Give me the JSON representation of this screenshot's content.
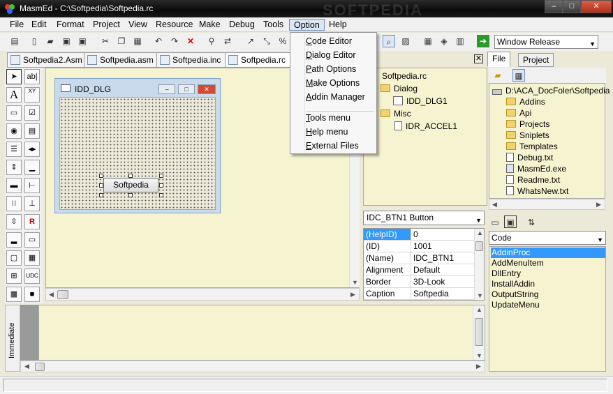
{
  "window": {
    "title": "MasmEd - C:\\Softpedia\\Softpedia.rc",
    "watermark": "SOFTPEDIA",
    "controls": {
      "minimize": "–",
      "maximize": "□",
      "close": "✕"
    }
  },
  "menubar": {
    "items": [
      "File",
      "Edit",
      "Format",
      "Project",
      "View",
      "Resource",
      "Make",
      "Debug",
      "Tools",
      "Option",
      "Help"
    ],
    "active": "Option"
  },
  "option_menu": {
    "group1": [
      {
        "label": "Code Editor",
        "accel": "C"
      },
      {
        "label": "Dialog Editor",
        "accel": "D"
      },
      {
        "label": "Path Options",
        "accel": "P"
      },
      {
        "label": "Make Options",
        "accel": "M"
      },
      {
        "label": "Addin Manager",
        "accel": "A"
      }
    ],
    "group2": [
      {
        "label": "Tools menu",
        "accel": "T"
      },
      {
        "label": "Help menu",
        "accel": "H"
      },
      {
        "label": "External Files",
        "accel": "E"
      }
    ]
  },
  "toolbar": {
    "build_config": "Window Release"
  },
  "doc_tabs": [
    {
      "label": "Softpedia2.Asm",
      "active": false
    },
    {
      "label": "Softpedia.asm",
      "active": false
    },
    {
      "label": "Softpedia.inc",
      "active": false
    },
    {
      "label": "Softpedia.rc",
      "active": true
    }
  ],
  "toolbox": {
    "tools": [
      "pointer-icon",
      "edit-box-icon",
      "static-text-icon",
      "groupbox-icon",
      "button-icon",
      "checkbox-icon",
      "radio-icon",
      "combo-icon",
      "listbox-icon",
      "tabstrip-icon",
      "scrollbar-v-icon",
      "progress-icon",
      "hscroll-icon",
      "treeview-icon",
      "listview-icon",
      "trackbar-icon",
      "updown-icon",
      "rich-edit-icon",
      "statusbar-icon",
      "toolbar-icon",
      "image-icon",
      "grid-icon",
      "animate-icon",
      "udc-icon",
      "shape-icon",
      "color-icon"
    ],
    "labels": {
      "edit": "ab|",
      "static": "A",
      "group": "XY",
      "udc": "UDC"
    }
  },
  "dialog": {
    "title": "IDD_DLG",
    "button_label": "Softpedia"
  },
  "resource_tree": {
    "root": "Softpedia.rc",
    "nodes": [
      {
        "label": "Dialog",
        "type": "folder",
        "level": 1
      },
      {
        "label": "IDD_DLG1",
        "type": "dialog",
        "level": 2
      },
      {
        "label": "Misc",
        "type": "folder",
        "level": 1
      },
      {
        "label": "IDR_ACCEL1",
        "type": "file",
        "level": 2
      }
    ]
  },
  "properties": {
    "selected_control": "IDC_BTN1 Button",
    "rows": [
      {
        "name": "(HelpID)",
        "value": "0",
        "selected": true
      },
      {
        "name": "(ID)",
        "value": "1001",
        "selected": false
      },
      {
        "name": "(Name)",
        "value": "IDC_BTN1",
        "selected": false
      },
      {
        "name": "Alignment",
        "value": "Default",
        "selected": false
      },
      {
        "name": "Border",
        "value": "3D-Look",
        "selected": false
      },
      {
        "name": "Caption",
        "value": "Softpedia",
        "selected": false
      }
    ]
  },
  "project_panel": {
    "tabs": [
      "File",
      "Project"
    ],
    "active_tab": "File",
    "path": "D:\\ACA_DocFoler\\Softpedia",
    "items": [
      {
        "label": "Addins",
        "type": "folder"
      },
      {
        "label": "Api",
        "type": "folder"
      },
      {
        "label": "Projects",
        "type": "folder"
      },
      {
        "label": "Sniplets",
        "type": "folder"
      },
      {
        "label": "Templates",
        "type": "folder"
      },
      {
        "label": "Debug.txt",
        "type": "file"
      },
      {
        "label": "MasmEd.exe",
        "type": "exe"
      },
      {
        "label": "Readme.txt",
        "type": "file"
      },
      {
        "label": "WhatsNew.txt",
        "type": "file"
      }
    ]
  },
  "code_panel": {
    "filter": "Code",
    "procs": [
      "AddinProc",
      "AddMenuItem",
      "DllEntry",
      "InstallAddin",
      "OutputString",
      "UpdateMenu"
    ],
    "selected": "AddinProc"
  },
  "immediate": {
    "label": "Immediate"
  },
  "colors": {
    "editor_bg": "#f5f3d0",
    "selection": "#3399ff",
    "titlebar": "#111111"
  }
}
